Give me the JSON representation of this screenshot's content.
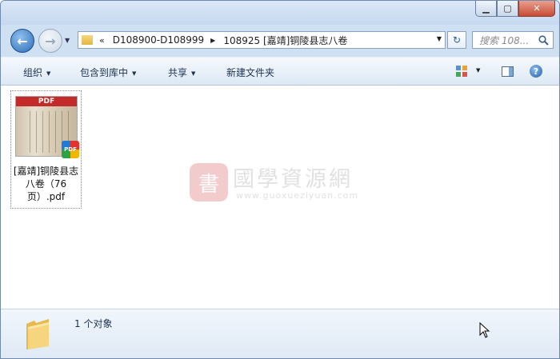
{
  "window": {
    "minimize_glyph": "▁",
    "maximize_glyph": "▢",
    "close_glyph": "✕"
  },
  "nav": {
    "back_glyph": "←",
    "forward_glyph": "→",
    "address": {
      "overflow": "«",
      "crumbs": [
        "D108900-D108999",
        "108925 [嘉靖]铜陵县志八卷"
      ]
    },
    "refresh_glyph": "↻",
    "search_placeholder": "搜索 108..."
  },
  "toolbar": {
    "organize": "组织",
    "include_in_library": "包含到库中",
    "share": "共享",
    "new_folder": "新建文件夹"
  },
  "file": {
    "thumb_label": "PDF",
    "badge": "PDF",
    "name": "[嘉靖]铜陵县志八卷（76页）.pdf"
  },
  "watermark": {
    "logo_char": "書",
    "title": "國學資源網",
    "url": "www.guoxueziyuan.com"
  },
  "status": {
    "count_text": "1 个对象"
  },
  "colors": {
    "accent": "#2c6db5",
    "toolbar_text": "#1e3250",
    "pdf_red": "#c32a2a"
  }
}
